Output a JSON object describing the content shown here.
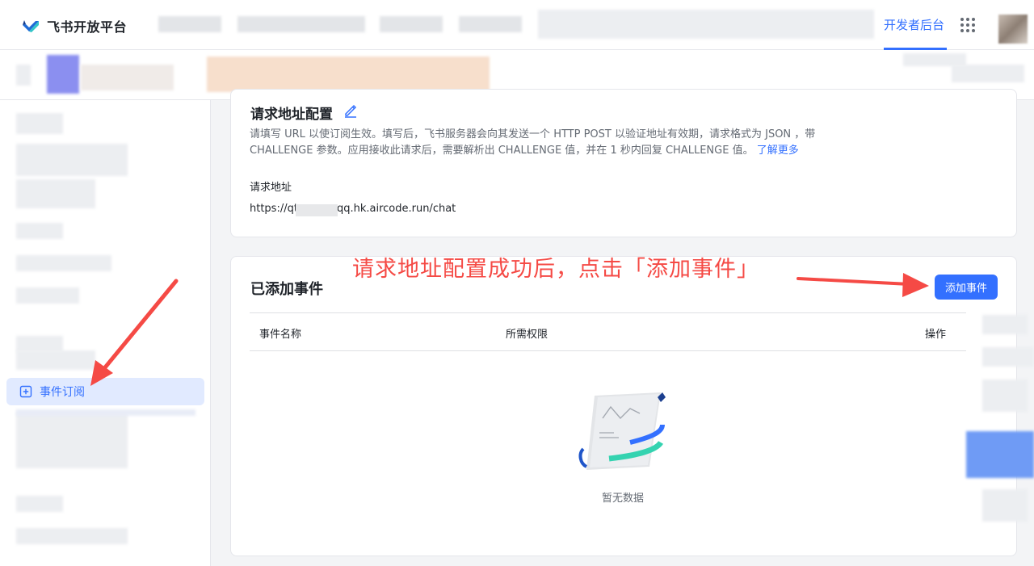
{
  "header": {
    "brand": "飞书开放平台",
    "dev_console": "开发者后台"
  },
  "sidebar": {
    "active_item": "事件订阅"
  },
  "url_config": {
    "title": "请求地址配置",
    "description_1": "请填写 URL 以使订阅生效。填写后，飞书服务器会向其发送一个 HTTP POST 以验证地址有效期，请求格式为 JSON ，带",
    "description_2": "CHALLENGE 参数。应用接收此请求后，需要解析出 CHALLENGE 值，并在 1 秒内回复 CHALLENGE 值。",
    "learn_more": "了解更多",
    "address_label": "请求地址",
    "address_prefix": "https://qt",
    "address_suffix": "qq.hk.aircode.run/chat"
  },
  "events": {
    "title": "已添加事件",
    "add_button": "添加事件",
    "columns": [
      "事件名称",
      "所需权限",
      "操作"
    ],
    "empty_text": "暂无数据"
  },
  "annotation": {
    "text": "请求地址配置成功后，点击「添加事件」",
    "color": "#f54a45"
  },
  "colors": {
    "accent": "#3370ff",
    "annotation_red": "#f54a45"
  }
}
